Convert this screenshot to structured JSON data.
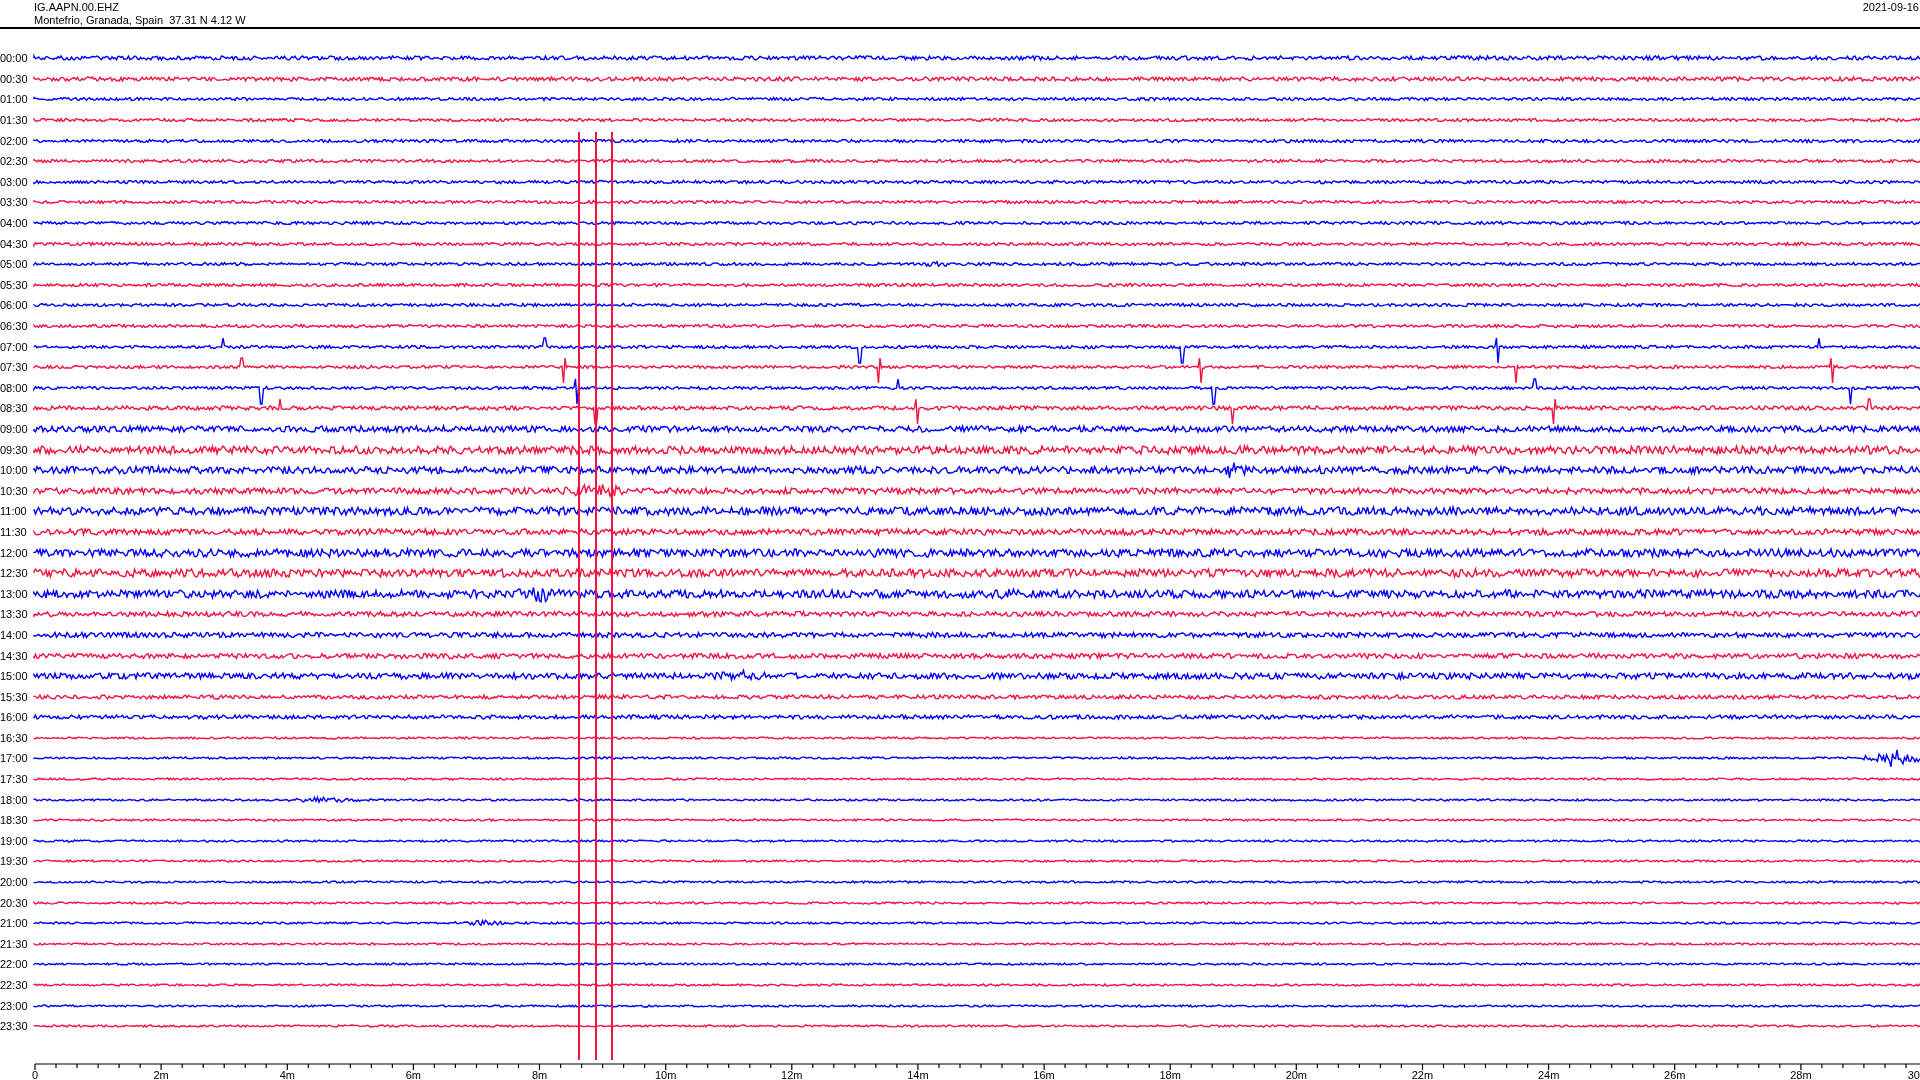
{
  "header": {
    "station": "IG.AAPN.00.EHZ",
    "location": "Montefrio, Granada, Spain  37.31 N 4.12 W",
    "date": "2021-09-16"
  },
  "rows": [
    {
      "time": "00:00",
      "color": "#0000ff"
    },
    {
      "time": "00:30",
      "color": "#f01441"
    },
    {
      "time": "01:00",
      "color": "#0000ff"
    },
    {
      "time": "01:30",
      "color": "#f01441"
    },
    {
      "time": "02:00",
      "color": "#0000ff"
    },
    {
      "time": "02:30",
      "color": "#f01441"
    },
    {
      "time": "03:00",
      "color": "#0000ff"
    },
    {
      "time": "03:30",
      "color": "#f01441"
    },
    {
      "time": "04:00",
      "color": "#0000ff"
    },
    {
      "time": "04:30",
      "color": "#f01441"
    },
    {
      "time": "05:00",
      "color": "#0000ff"
    },
    {
      "time": "05:30",
      "color": "#f01441"
    },
    {
      "time": "06:00",
      "color": "#0000ff"
    },
    {
      "time": "06:30",
      "color": "#f01441"
    },
    {
      "time": "07:00",
      "color": "#0000ff"
    },
    {
      "time": "07:30",
      "color": "#f01441"
    },
    {
      "time": "08:00",
      "color": "#0000ff"
    },
    {
      "time": "08:30",
      "color": "#f01441"
    },
    {
      "time": "09:00",
      "color": "#0000ff"
    },
    {
      "time": "09:30",
      "color": "#f01441"
    },
    {
      "time": "10:00",
      "color": "#0000ff"
    },
    {
      "time": "10:30",
      "color": "#f01441"
    },
    {
      "time": "11:00",
      "color": "#0000ff"
    },
    {
      "time": "11:30",
      "color": "#f01441"
    },
    {
      "time": "12:00",
      "color": "#0000ff"
    },
    {
      "time": "12:30",
      "color": "#f01441"
    },
    {
      "time": "13:00",
      "color": "#0000ff"
    },
    {
      "time": "13:30",
      "color": "#f01441"
    },
    {
      "time": "14:00",
      "color": "#0000ff"
    },
    {
      "time": "14:30",
      "color": "#f01441"
    },
    {
      "time": "15:00",
      "color": "#0000ff"
    },
    {
      "time": "15:30",
      "color": "#f01441"
    },
    {
      "time": "16:00",
      "color": "#0000ff"
    },
    {
      "time": "16:30",
      "color": "#f01441"
    },
    {
      "time": "17:00",
      "color": "#0000ff"
    },
    {
      "time": "17:30",
      "color": "#f01441"
    },
    {
      "time": "18:00",
      "color": "#0000ff"
    },
    {
      "time": "18:30",
      "color": "#f01441"
    },
    {
      "time": "19:00",
      "color": "#0000ff"
    },
    {
      "time": "19:30",
      "color": "#f01441"
    },
    {
      "time": "20:00",
      "color": "#0000ff"
    },
    {
      "time": "20:30",
      "color": "#f01441"
    },
    {
      "time": "21:00",
      "color": "#0000ff"
    },
    {
      "time": "21:30",
      "color": "#f01441"
    },
    {
      "time": "22:00",
      "color": "#0000ff"
    },
    {
      "time": "22:30",
      "color": "#f01441"
    },
    {
      "time": "23:00",
      "color": "#0000ff"
    },
    {
      "time": "23:30",
      "color": "#f01441"
    }
  ],
  "x_axis": {
    "labels": [
      "0",
      "2m",
      "4m",
      "6m",
      "8m",
      "10m",
      "12m",
      "14m",
      "16m",
      "18m",
      "20m",
      "22m",
      "24m",
      "26m",
      "28m",
      "30"
    ]
  }
}
